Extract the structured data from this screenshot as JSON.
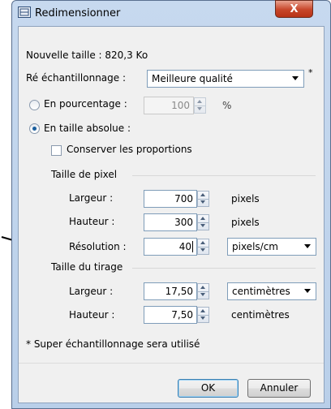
{
  "window": {
    "title": "Redimensionner",
    "close_label": "X"
  },
  "info": {
    "new_size": "Nouvelle taille : 820,3 Ko"
  },
  "resampling": {
    "label": "Ré échantillonnage :",
    "value": "Meilleure qualité",
    "note_marker": "*"
  },
  "percent": {
    "label": "En pourcentage :",
    "value": "100",
    "unit": "%",
    "selected": false
  },
  "absolute": {
    "label": "En taille absolue :",
    "selected": true,
    "keep_proportions_label": "Conserver les proportions",
    "keep_proportions_checked": false
  },
  "pixel_size": {
    "group_label": "Taille de pixel",
    "width_label": "Largeur :",
    "width_value": "700",
    "width_unit": "pixels",
    "height_label": "Hauteur :",
    "height_value": "300",
    "height_unit": "pixels",
    "resolution_label": "Résolution :",
    "resolution_value": "40",
    "resolution_unit": "pixels/cm"
  },
  "print_size": {
    "group_label": "Taille du tirage",
    "width_label": "Largeur :",
    "width_value": "17,50",
    "width_unit": "centimètres",
    "height_label": "Hauteur :",
    "height_value": "7,50",
    "height_unit": "centimètres"
  },
  "footnote": "* Super échantillonnage sera utilisé",
  "buttons": {
    "ok": "OK",
    "cancel": "Annuler"
  }
}
